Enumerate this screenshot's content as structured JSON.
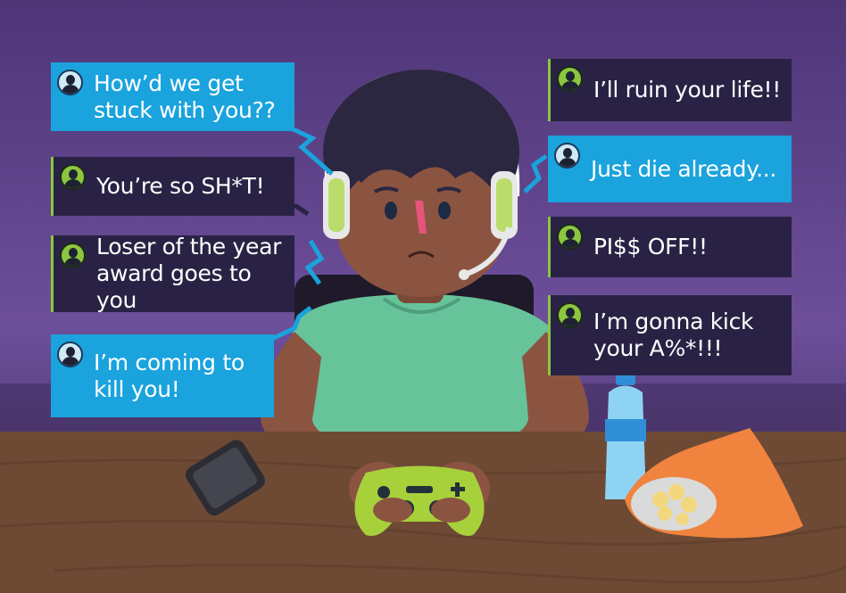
{
  "messages_left": [
    {
      "text": "How’d we get stuck with you??",
      "style": "blue"
    },
    {
      "text": "You’re so SH*T!",
      "style": "dark"
    },
    {
      "text": "Loser of the year award goes to you",
      "style": "dark"
    },
    {
      "text": "I’m coming to kill you!",
      "style": "blue"
    }
  ],
  "messages_right": [
    {
      "text": "I’ll ruin your life!!",
      "style": "dark"
    },
    {
      "text": "Just die already...",
      "style": "blue"
    },
    {
      "text": "PI$$ OFF!!",
      "style": "dark"
    },
    {
      "text": "I’m gonna kick your A%*!!!",
      "style": "dark"
    }
  ],
  "colors": {
    "background": "#5b3f86",
    "desk": "#6e4a34",
    "bubble_blue": "#1aa3dd",
    "bubble_dark": "#2a2244",
    "accent_green": "#8cc63f",
    "shirt": "#67c39a",
    "skin": "#8b5441",
    "controller": "#a7d13b",
    "chips_bag": "#f0833e"
  }
}
